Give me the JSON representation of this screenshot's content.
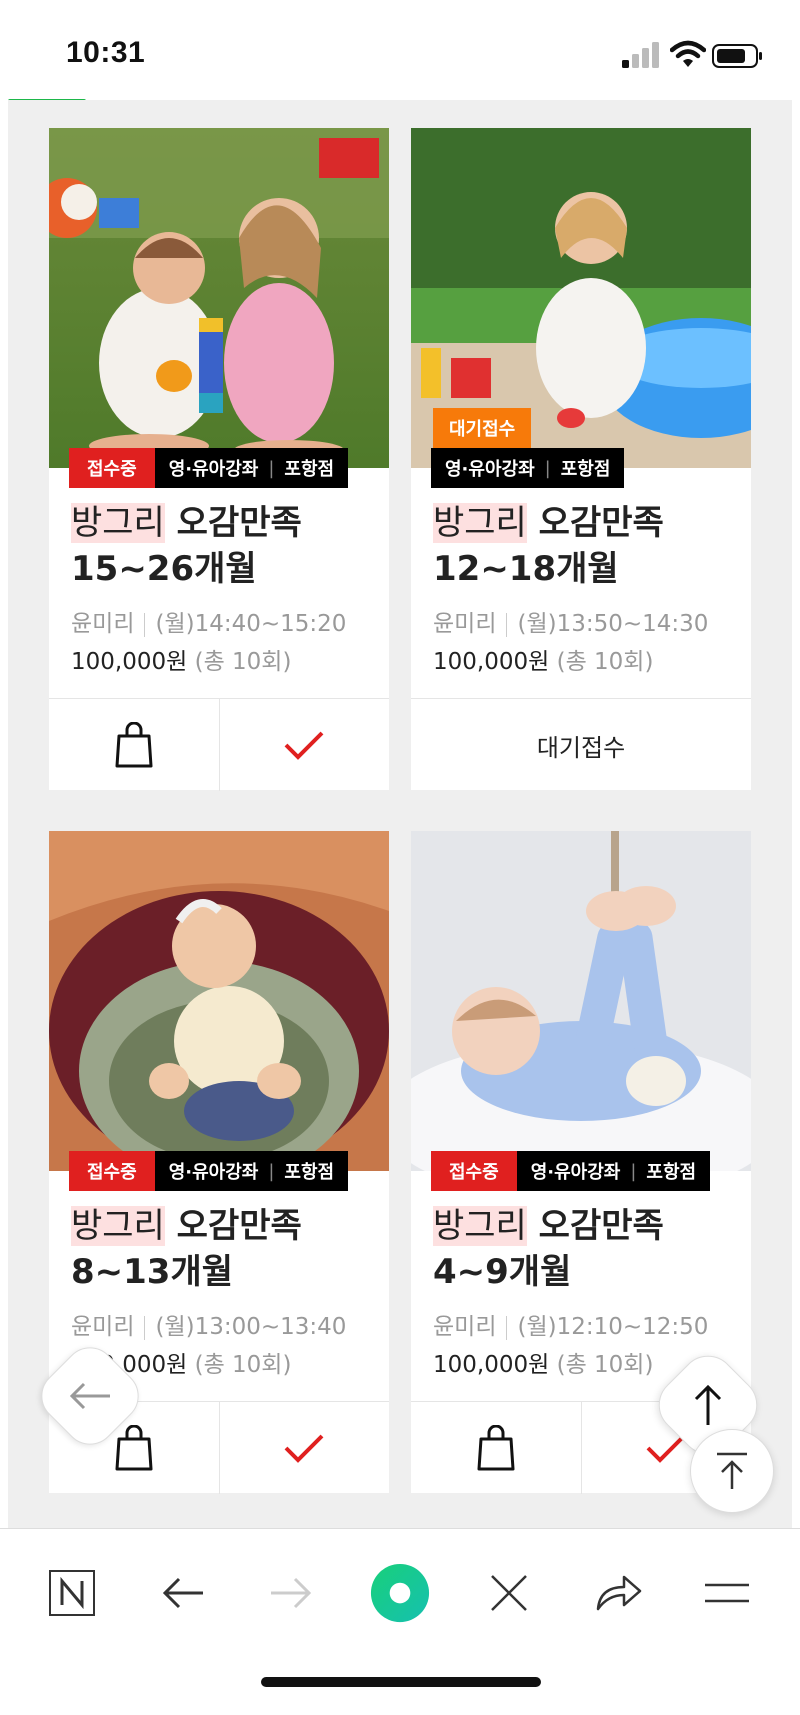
{
  "status_bar": {
    "time": "10:31"
  },
  "colors": {
    "accent_green": "#1db74a",
    "status_red": "#e0201f",
    "wait_orange": "#f77a0a",
    "highlight_pink": "#fde0e0"
  },
  "cards": [
    {
      "status": "접수중",
      "category": "영·유아강좌",
      "branch": "포항점",
      "highlight": "방그리",
      "title_rest": " 오감만족",
      "age": "15~26개월",
      "instructor": "윤미리",
      "schedule": "(월)14:40~15:20",
      "price": "100,000원",
      "sessions": "(총 10회)"
    },
    {
      "wait_badge": "대기접수",
      "category": "영·유아강좌",
      "branch": "포항점",
      "highlight": "방그리",
      "title_rest": " 오감만족",
      "age": "12~18개월",
      "instructor": "윤미리",
      "schedule": "(월)13:50~14:30",
      "price": "100,000원",
      "sessions": "(총 10회)",
      "action_label": "대기접수"
    },
    {
      "status": "접수중",
      "category": "영·유아강좌",
      "branch": "포항점",
      "highlight": "방그리",
      "title_rest": " 오감만족",
      "age": "8~13개월",
      "instructor": "윤미리",
      "schedule": "(월)13:00~13:40",
      "price": "100,000원",
      "sessions": "(총 10회)"
    },
    {
      "status": "접수중",
      "category": "영·유아강좌",
      "branch": "포항점",
      "highlight": "방그리",
      "title_rest": " 오감만족",
      "age": "4~9개월",
      "instructor": "윤미리",
      "schedule": "(월)12:10~12:50",
      "price": "100,000원",
      "sessions": "(총 10회)"
    }
  ],
  "icons": {
    "cart": "shopping-bag-icon",
    "select": "checkmark-icon",
    "back": "arrow-left-icon",
    "up": "arrow-up-icon",
    "top": "scroll-top-icon"
  },
  "toolbar": [
    "naver-home-icon",
    "back-arrow-icon",
    "forward-arrow-icon",
    "green-dot-icon",
    "close-icon",
    "share-icon",
    "menu-icon"
  ]
}
